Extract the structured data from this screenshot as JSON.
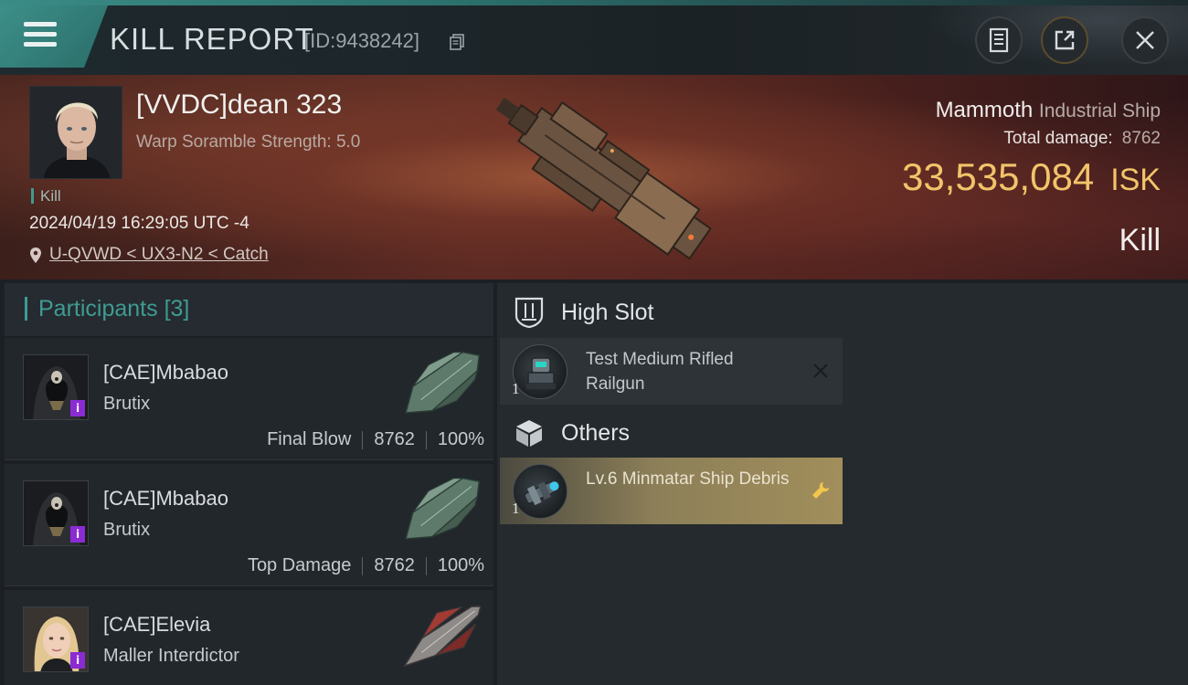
{
  "header": {
    "title": "KILL REPORT",
    "report_id": "[ID:9438242]"
  },
  "victim": {
    "name": "[VVDC]dean 323",
    "warp_scramble": "Warp Soramble Strength: 5.0",
    "tag": "Kill",
    "timestamp": "2024/04/19 16:29:05 UTC -4",
    "location": "U-QVWD < UX3-N2 < Catch",
    "ship_name": "Mammoth",
    "ship_class": "Industrial Ship",
    "total_damage_label": "Total damage:",
    "total_damage": "8762",
    "isk_value": "33,535,084",
    "isk_unit": "ISK",
    "result": "Kill"
  },
  "participants": {
    "label": "Participants",
    "count": "[3]",
    "rows": [
      {
        "name": "[CAE]Mbabao",
        "ship": "Brutix",
        "role": "Final Blow",
        "damage": "8762",
        "percent": "100%"
      },
      {
        "name": "[CAE]Mbabao",
        "ship": "Brutix",
        "role": "Top Damage",
        "damage": "8762",
        "percent": "100%"
      },
      {
        "name": "[CAE]Elevia",
        "ship": "Maller Interdictor",
        "role": "",
        "damage": "",
        "percent": ""
      }
    ],
    "badge": "i"
  },
  "modules": {
    "high_slot": {
      "label": "High Slot",
      "items": [
        {
          "qty": "1",
          "name": "Test Medium Rifled Railgun",
          "state": "destroyed"
        }
      ]
    },
    "others": {
      "label": "Others",
      "items": [
        {
          "qty": "1",
          "name": "Lv.6 Minmatar Ship Debris",
          "state": "dropped"
        }
      ]
    }
  },
  "colors": {
    "accent_teal": "#3f9b93",
    "isk_gold": "#f2c46a",
    "dropped_item": "#a18e5b",
    "role_badge": "#8a2bd4"
  }
}
